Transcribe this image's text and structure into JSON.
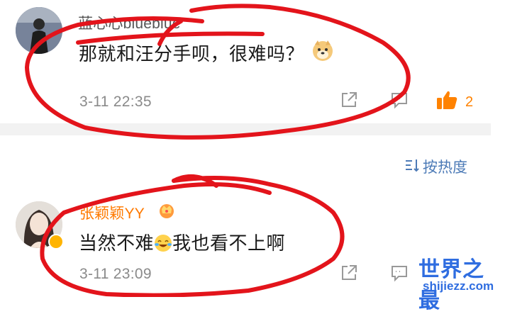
{
  "comments": [
    {
      "username": "蓝心心blueblue",
      "text": "那就和汪分手呗，很难吗？",
      "time": "3-11 22:35",
      "likes": "2"
    },
    {
      "username": "张颖颖YY",
      "text_before_emoji": "当然不难",
      "text_after_emoji": "我也看不上啊",
      "time": "3-11 23:09"
    }
  ],
  "sort": {
    "label": "按热度"
  },
  "watermark": {
    "title": "世界之最",
    "url": "shijiezz.com"
  },
  "colors": {
    "accent_orange": "#ff8200",
    "link_blue": "#4d7bb7",
    "annotation_red": "#e3141b",
    "watermark_blue": "#2f6de0"
  }
}
